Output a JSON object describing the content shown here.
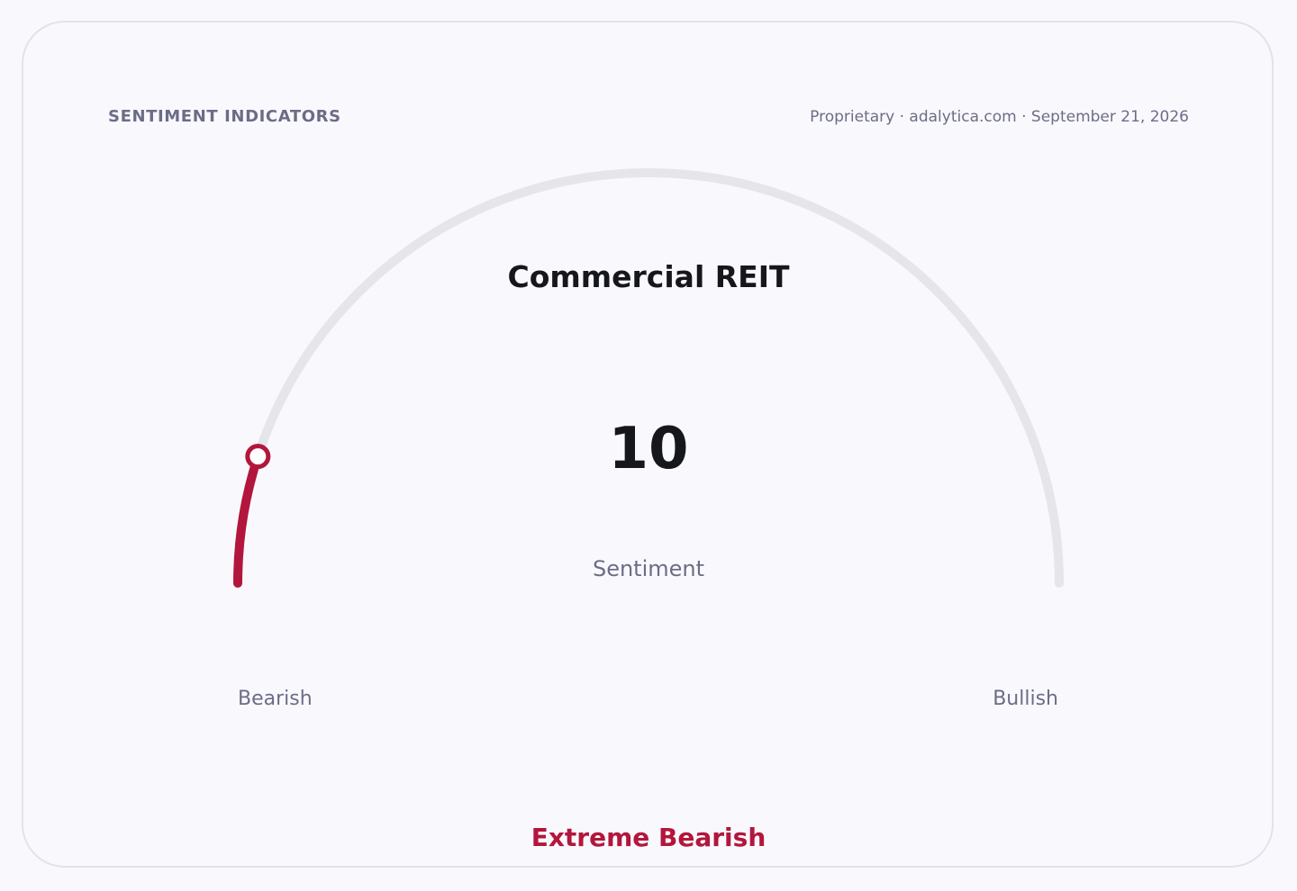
{
  "header": {
    "section_title": "SENTIMENT INDICATORS",
    "source_line": "Proprietary · adalytica.com · September 21, 2026"
  },
  "gauge": {
    "title": "Commercial REIT",
    "value_label": "10",
    "caption": "Sentiment",
    "min_label": "Bearish",
    "max_label": "Bullish",
    "status": "Extreme Bearish"
  },
  "colors": {
    "track": "#e5e5ea",
    "accent": "#b3163c",
    "text_primary": "#16161d",
    "text_secondary": "#6c6c88"
  },
  "chart_data": {
    "type": "gauge",
    "title": "Commercial REIT",
    "value": 10,
    "min": 0,
    "max": 100,
    "min_label": "Bearish",
    "max_label": "Bullish",
    "status": "Extreme Bearish"
  }
}
